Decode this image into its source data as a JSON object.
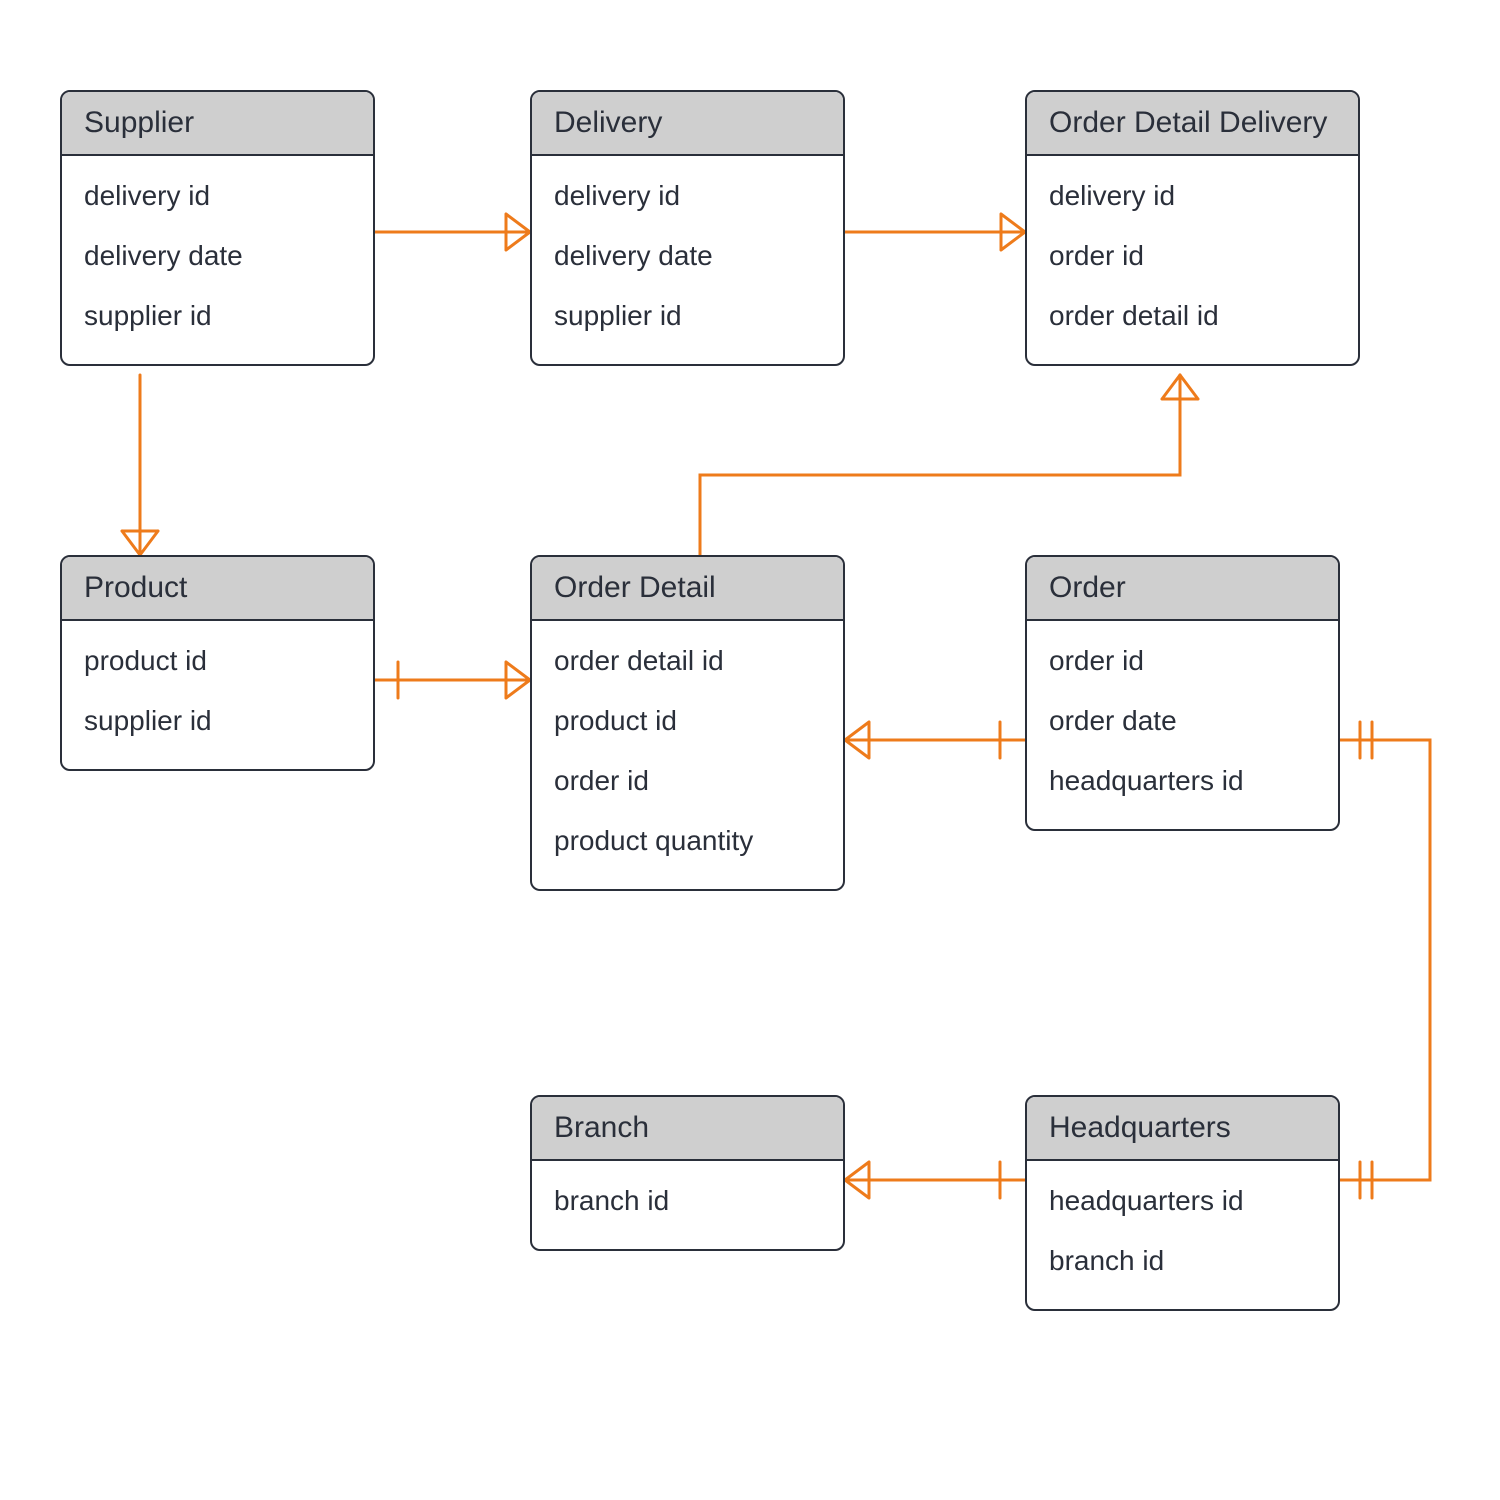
{
  "entities": {
    "supplier": {
      "title": "Supplier",
      "attrs": [
        "delivery id",
        "delivery date",
        "supplier id"
      ]
    },
    "delivery": {
      "title": "Delivery",
      "attrs": [
        "delivery id",
        "delivery date",
        "supplier id"
      ]
    },
    "order_detail_delivery": {
      "title": "Order Detail Delivery",
      "attrs": [
        "delivery id",
        "order id",
        "order detail id"
      ]
    },
    "product": {
      "title": "Product",
      "attrs": [
        "product id",
        "supplier id"
      ]
    },
    "order_detail": {
      "title": "Order Detail",
      "attrs": [
        "order detail id",
        "product id",
        "order id",
        "product quantity"
      ]
    },
    "order": {
      "title": "Order",
      "attrs": [
        "order id",
        "order date",
        "headquarters id"
      ]
    },
    "branch": {
      "title": "Branch",
      "attrs": [
        "branch id"
      ]
    },
    "headquarters": {
      "title": "Headquarters",
      "attrs": [
        "headquarters id",
        "branch id"
      ]
    }
  },
  "colors": {
    "connector": "#ee7b1b",
    "box_border": "#2a2f3a",
    "title_bg": "#cfcfcf"
  }
}
